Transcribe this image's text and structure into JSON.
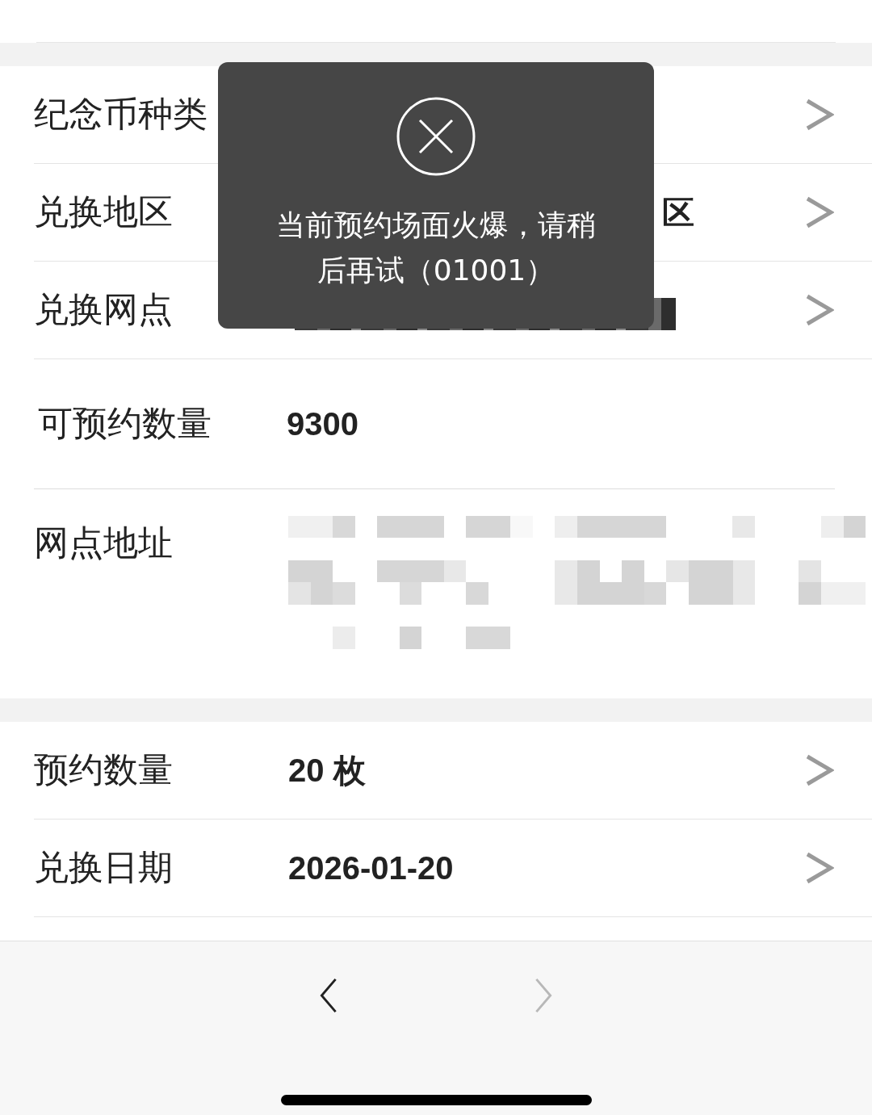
{
  "sections": [
    {
      "rows": [
        {
          "kind": "covered-select",
          "label": "纪念币种类"
        },
        {
          "kind": "covered-select",
          "label": "兑换地区",
          "value": "区"
        },
        {
          "kind": "redacted-select",
          "label": "兑换网点"
        },
        {
          "kind": "plain",
          "label": "可预约数量",
          "value": "9300"
        },
        {
          "kind": "address",
          "label": "网点地址"
        }
      ]
    },
    {
      "rows": [
        {
          "kind": "select",
          "label": "预约数量",
          "value": "20 枚"
        },
        {
          "kind": "select",
          "label": "兑换日期",
          "value": "2026-01-20"
        }
      ]
    }
  ],
  "toast": {
    "message": "当前预约场面火爆，请稍后再试（01001）"
  },
  "toolbar": {
    "back": {
      "disabled": false
    },
    "forward": {
      "disabled": true
    }
  }
}
